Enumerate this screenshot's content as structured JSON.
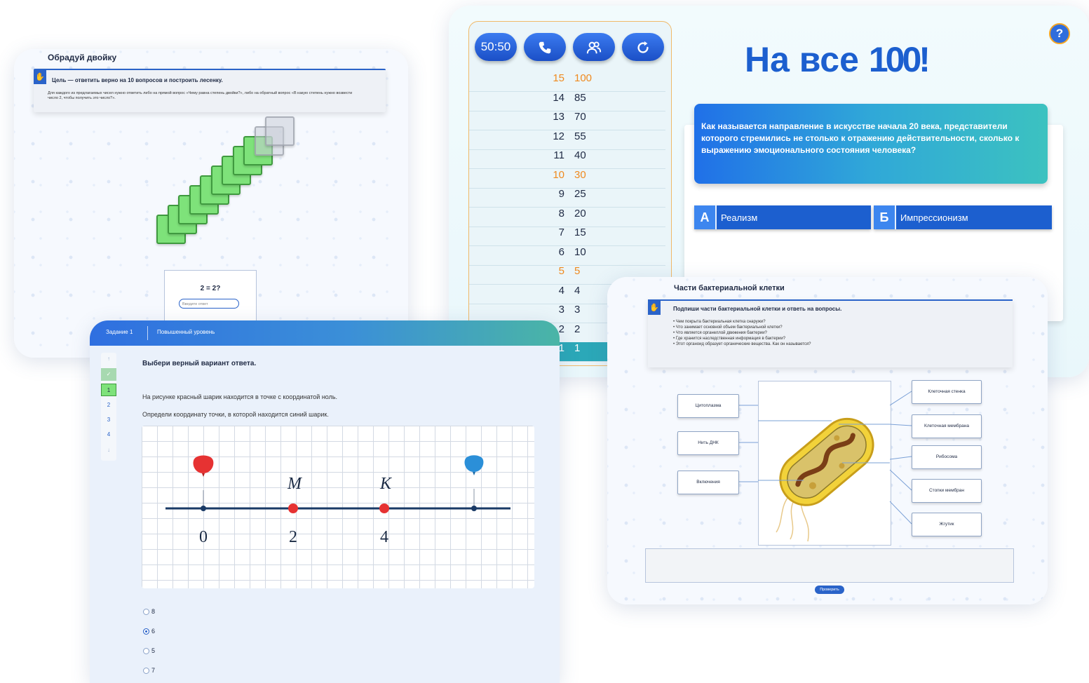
{
  "card1": {
    "title": "Обрадуй двойку",
    "goal": "Цель — ответить верно на 10 вопросов и построить лесенку.",
    "description": "Для каждого из предлагаемых чисел нужно ответить либо на прямой вопрос «Чему равна степень двойки?», либо на обратный вопрос «В какую степень нужно возвести число 2, чтобы получить это число?».",
    "equation": "2 = 2?",
    "answer_placeholder": "Введите ответ",
    "steps_done": 9,
    "steps_total": 10
  },
  "card2": {
    "lifelines": [
      "50:50",
      "phone-icon",
      "audience-icon",
      "refresh-icon"
    ],
    "lifeline_label_5050": "50:50",
    "logo_text": "На все",
    "logo_number": "100",
    "logo_suffix": "!",
    "help": "?",
    "ladder": [
      {
        "n": "15",
        "prize": "100",
        "milestone": true
      },
      {
        "n": "14",
        "prize": "85"
      },
      {
        "n": "13",
        "prize": "70"
      },
      {
        "n": "12",
        "prize": "55"
      },
      {
        "n": "11",
        "prize": "40"
      },
      {
        "n": "10",
        "prize": "30",
        "milestone": true
      },
      {
        "n": "9",
        "prize": "25"
      },
      {
        "n": "8",
        "prize": "20"
      },
      {
        "n": "7",
        "prize": "15"
      },
      {
        "n": "6",
        "prize": "10"
      },
      {
        "n": "5",
        "prize": "5",
        "milestone": true
      },
      {
        "n": "4",
        "prize": "4"
      },
      {
        "n": "3",
        "prize": "3"
      },
      {
        "n": "2",
        "prize": "2"
      },
      {
        "n": "1",
        "prize": "1",
        "current": true
      }
    ],
    "question": "Как называется направление в искусстве начала 20 века, представители которого стремились не столько к отражению действительности, сколько к выражению эмоционального состояния человека?",
    "options": [
      {
        "letter": "А",
        "text": "Реализм"
      },
      {
        "letter": "Б",
        "text": "Импрессионизм"
      }
    ]
  },
  "card3": {
    "tab1": "Задание 1",
    "tab2": "Повышенный уровень",
    "sidebar": [
      "1",
      "2",
      "3",
      "4"
    ],
    "task": "Выбери верный вариант ответа.",
    "p1": "На рисунке красный шарик находится в точке с координатой ноль.",
    "p2": "Определи координату точки, в которой находится синий шарик.",
    "labels": {
      "m": "M",
      "k": "K",
      "t0": "0",
      "t2": "2",
      "t4": "4"
    },
    "options": [
      {
        "label": "8",
        "selected": false
      },
      {
        "label": "6",
        "selected": true
      },
      {
        "label": "5",
        "selected": false
      },
      {
        "label": "7",
        "selected": false
      }
    ]
  },
  "card4": {
    "title": "Части бактериальной клетки",
    "instruction": "Подпиши части бактериальной клетки и ответь на вопросы.",
    "questions": [
      "Чем покрыта бактериальная клетка снаружи?",
      "Что занимает основной объем бактериальной клетки?",
      "Что является органеллой движения бактерии?",
      "Где хранится наследственная информация в бактерии?",
      "Этот органоид образует органические вещества. Как он называется?"
    ],
    "left_labels": [
      "Цитоплазма",
      "Нить ДНК",
      "Включения"
    ],
    "right_labels": [
      "Клеточная стенка",
      "Клеточная мембрана",
      "Рибосома",
      "Стопки мембран",
      "Жгутик"
    ],
    "check_button": "Проверить"
  },
  "colors": {
    "primary": "#1c5fcf",
    "accent": "#ef8a1f",
    "success": "#7ee27a",
    "red_ball": "#e63232",
    "blue_ball": "#2b8fd8"
  }
}
